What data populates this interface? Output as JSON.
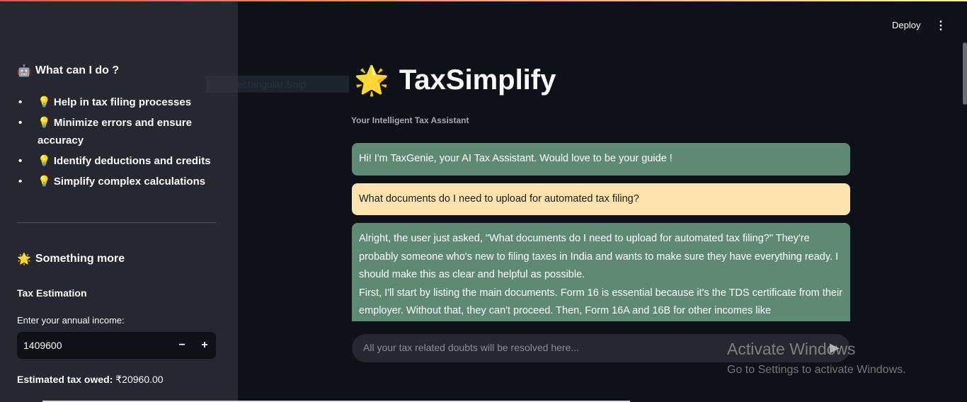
{
  "sidebar": {
    "what_title": "What can I do ?",
    "what_icon": "robot-icon",
    "items": [
      {
        "label": "Help in tax filing processes"
      },
      {
        "label": "Minimize errors and ensure accuracy"
      },
      {
        "label": "Identify deductions and credits"
      },
      {
        "label": "Simplify complex calculations"
      }
    ],
    "item_icon": "💡",
    "more_title": "Something more",
    "tax_title": "Tax Estimation",
    "income_label": "Enter your annual income:",
    "income_value": "1409600",
    "minus": "−",
    "plus": "+",
    "tax_owed_label": "Estimated tax owed:",
    "tax_owed_value": "₹20960.00"
  },
  "overlay": {
    "snip": "Rectangular Snip"
  },
  "header": {
    "deploy": "Deploy",
    "menu": "⋮"
  },
  "main": {
    "title": "TaxSimplify",
    "star": "🌟",
    "subtitle": "Your Intelligent Tax Assistant",
    "messages": [
      {
        "role": "assistant",
        "text": "Hi! I'm TaxGenie, your AI Tax Assistant. Would love to be your guide !"
      },
      {
        "role": "user",
        "text": "What documents do I need to upload for automated tax filing?"
      },
      {
        "role": "assistant",
        "text": "Alright, the user just asked, \"What documents do I need to upload for automated tax filing?\" They're probably someone who's new to filing taxes in India and wants to make sure they have everything ready. I should make this as clear and helpful as possible.",
        "text2": "First, I'll start by listing the main documents. Form 16 is essential because it's the TDS certificate from their employer. Without that, they can't proceed. Then, Form 16A and 16B for other incomes like"
      }
    ],
    "chat_placeholder": "All your tax related doubts will be resolved here..."
  },
  "watermark": {
    "line1": "Activate Windows",
    "line2": "Go to Settings to activate Windows."
  }
}
